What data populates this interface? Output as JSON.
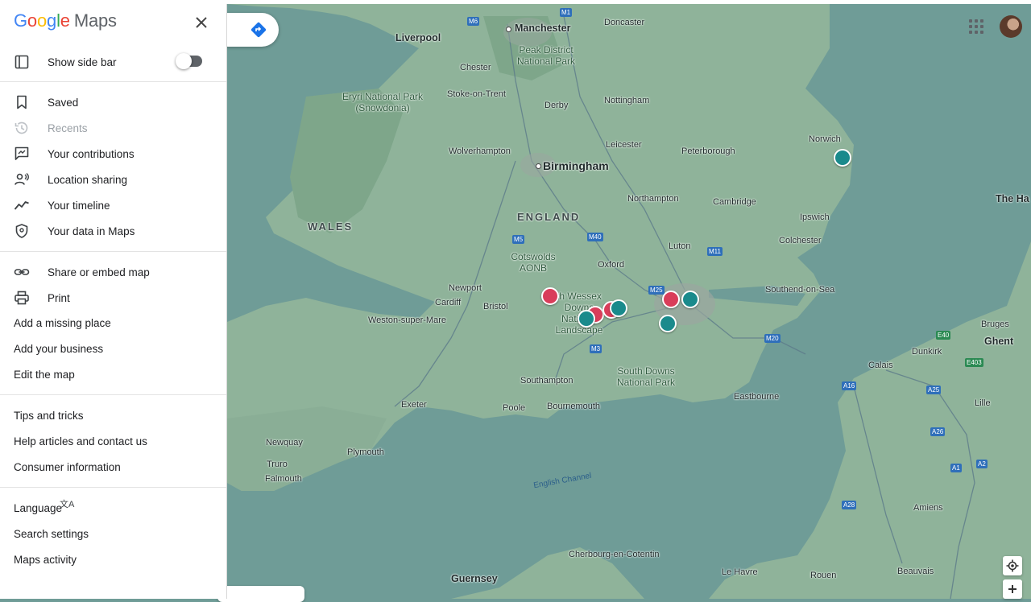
{
  "app": {
    "logo_word": "Google",
    "logo_suffix": "Maps"
  },
  "menu": {
    "toggle_row": {
      "label": "Show side bar",
      "checked": false
    },
    "group1": [
      {
        "label": "Saved",
        "icon": "bookmark-icon"
      },
      {
        "label": "Recents",
        "icon": "history-icon",
        "disabled": true
      },
      {
        "label": "Your contributions",
        "icon": "contributions-icon"
      },
      {
        "label": "Location sharing",
        "icon": "people-icon"
      },
      {
        "label": "Your timeline",
        "icon": "timeline-icon"
      },
      {
        "label": "Your data in Maps",
        "icon": "shield-icon"
      }
    ],
    "group2": [
      {
        "label": "Share or embed map",
        "icon": "link-icon"
      },
      {
        "label": "Print",
        "icon": "print-icon"
      },
      {
        "label": "Add a missing place"
      },
      {
        "label": "Add your business"
      },
      {
        "label": "Edit the map"
      }
    ],
    "group3": [
      {
        "label": "Tips and tricks"
      },
      {
        "label": "Help articles and contact us"
      },
      {
        "label": "Consumer information"
      }
    ],
    "group4": [
      {
        "label": "Language",
        "icon": "translate-icon"
      },
      {
        "label": "Search settings"
      },
      {
        "label": "Maps activity"
      }
    ]
  },
  "map": {
    "cities": [
      "Manchester",
      "Liverpool",
      "Doncaster",
      "Chester",
      "Stoke-on-Trent",
      "Derby",
      "Nottingham",
      "Norwich",
      "Wolverhampton",
      "Birmingham",
      "Leicester",
      "Peterborough",
      "Northampton",
      "Cambridge",
      "Ipswich",
      "Colchester",
      "Luton",
      "Oxford",
      "Newport",
      "Cardiff",
      "Bristol",
      "Southend-on-Sea",
      "Weston-super-Mare",
      "Bruges",
      "Ghent",
      "Dunkirk",
      "Calais",
      "Southampton",
      "Eastbourne",
      "Lille",
      "Exeter",
      "Poole",
      "Bournemouth",
      "Newquay",
      "Plymouth",
      "Truro",
      "Falmouth",
      "Amiens",
      "Cherbourg-en-Cotentin",
      "Le Havre",
      "Rouen",
      "Beauvais",
      "Guernsey",
      "The Ha"
    ],
    "regions": [
      "WALES",
      "ENGLAND"
    ],
    "parks": [
      "Peak District National Park",
      "Eryri National Park (Snowdonia)",
      "Cotswolds AONB",
      "th Wessex Downs National Landscape",
      "South Downs National Park"
    ],
    "sea": "English Channel",
    "roads": [
      "M6",
      "M1",
      "M5",
      "M40",
      "M11",
      "M25",
      "M3",
      "M20",
      "E40",
      "E403",
      "A16",
      "A25",
      "A26",
      "A1",
      "A2",
      "A28"
    ]
  }
}
